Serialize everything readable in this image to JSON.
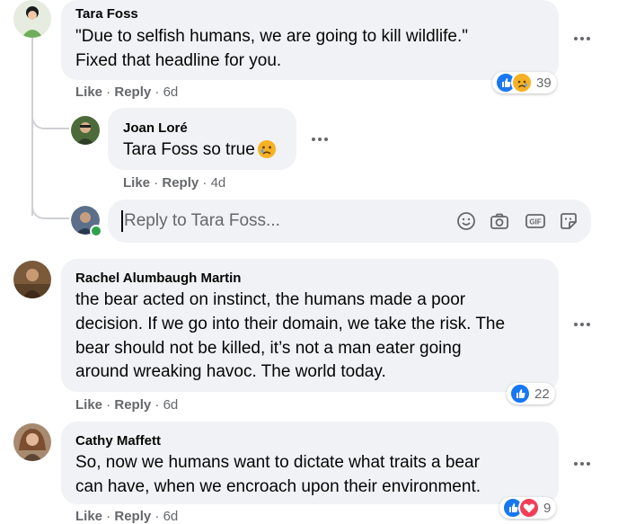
{
  "comments": [
    {
      "author": "Tara Foss",
      "lines": [
        "\"Due to selfish humans, we are going to kill wildlife.\"",
        "Fixed that headline for you."
      ],
      "like": "Like",
      "reply": "Reply",
      "time": "6d",
      "reaction_count": "39",
      "reaction_types": [
        "like",
        "sad"
      ]
    },
    {
      "author": "Joan Loré",
      "mention": "Tara Foss",
      "text": " so true",
      "like": "Like",
      "reply": "Reply",
      "time": "4d"
    },
    {
      "author": "Rachel Alumbaugh Martin",
      "lines": [
        "the bear acted on instinct, the humans made a poor",
        "decision. If we go into their domain, we take the risk. The",
        "bear should not be killed, it’s not a man eater going",
        "around wreaking havoc. The world today."
      ],
      "like": "Like",
      "reply": "Reply",
      "time": "6d",
      "reaction_count": "22",
      "reaction_types": [
        "like"
      ]
    },
    {
      "author": "Cathy Maffett",
      "lines": [
        "So, now we humans want to dictate what traits a bear",
        "can have, when we encroach upon their environment."
      ],
      "like": "Like",
      "reply": "Reply",
      "time": "6d",
      "reaction_count": "9",
      "reaction_types": [
        "like",
        "love"
      ]
    }
  ],
  "reply_box": {
    "placeholder": "Reply to Tara Foss...",
    "icons": [
      "smiley-icon",
      "camera-icon",
      "gif-icon",
      "sticker-icon"
    ]
  },
  "colors": {
    "bubble": "#f0f2f5",
    "secondary_text": "#65676b",
    "like_blue": "#1877f2",
    "love_red": "#f33e58",
    "online_green": "#31a24c"
  }
}
